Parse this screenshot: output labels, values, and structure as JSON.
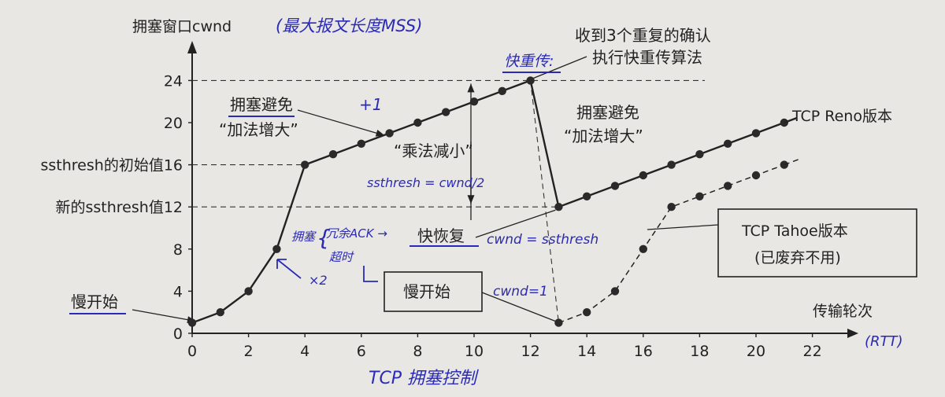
{
  "chart_data": {
    "type": "line",
    "title": "",
    "ylabel": "拥塞窗口cwnd",
    "ylabel_note": "(最大报文长度MSS)",
    "xlabel": "传输轮次",
    "xlabel_note": "(RTT)",
    "caption_note": "TCP 拥塞控制",
    "xlim": [
      0,
      22
    ],
    "ylim": [
      0,
      24
    ],
    "x_ticks": [
      "0",
      "2",
      "4",
      "6",
      "8",
      "10",
      "12",
      "14",
      "16",
      "18",
      "20",
      "22"
    ],
    "y_ticks": [
      "0",
      "4",
      "8",
      "12",
      "16",
      "20",
      "24"
    ],
    "y_ref_labels": {
      "16": "ssthresh的初始值16",
      "12": "新的ssthresh值12"
    },
    "series": [
      {
        "name": "TCP Reno版本",
        "style": "solid",
        "x": [
          0,
          1,
          2,
          3,
          4,
          5,
          6,
          7,
          8,
          9,
          10,
          11,
          12,
          13,
          14,
          15,
          16,
          17,
          18,
          19,
          20,
          21
        ],
        "y": [
          1,
          2,
          4,
          8,
          16,
          17,
          18,
          19,
          20,
          21,
          22,
          23,
          24,
          12,
          13,
          14,
          15,
          16,
          17,
          18,
          19,
          20
        ]
      },
      {
        "name": "TCP Tahoe版本",
        "style": "dashed",
        "x": [
          13,
          14,
          15,
          16,
          17,
          18,
          19,
          20,
          21
        ],
        "y": [
          1,
          2,
          4,
          8,
          12,
          13,
          14,
          15,
          16
        ]
      }
    ],
    "annotations": {
      "slow_start_label": "慢开始",
      "ca1_line1": "拥塞避免",
      "ca1_line2": "“加法增大”",
      "ca2_line1": "拥塞避免",
      "ca2_line2": "“加法增大”",
      "mult_dec": "“乘法减小”",
      "fast_retrans_line1": "收到3个重复的确认",
      "fast_retrans_line2": "执行快重传算法",
      "fast_recovery": "快恢复",
      "slow_start_box": "慢开始",
      "reno_label": "TCP Reno版本",
      "tahoe_line1": "TCP Tahoe版本",
      "tahoe_line2": "(已废弃不用)",
      "hw_plus1": "+1",
      "hw_ssthresh": "ssthresh = cwnd/2",
      "hw_fast_retrans": "快重传:",
      "hw_cwnd_ssthresh": "cwnd = ssthresh",
      "hw_cwnd_1": "cwnd=1",
      "hw_congestion": "拥塞",
      "hw_dup_ack": "冗余ACK →",
      "hw_timeout": "超时",
      "hw_x2": "×2"
    }
  }
}
